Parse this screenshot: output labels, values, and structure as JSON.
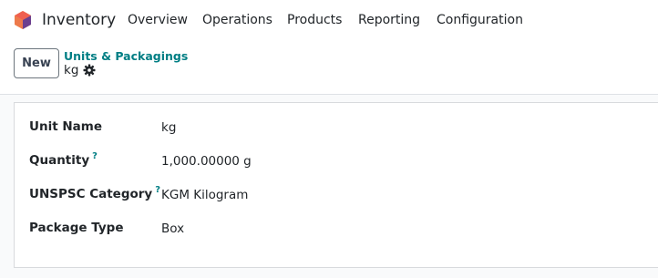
{
  "app": {
    "name": "Inventory",
    "brand_colors": [
      "#f06050",
      "#fbb130",
      "#6b3f8f"
    ]
  },
  "menu": [
    {
      "label": "Overview"
    },
    {
      "label": "Operations"
    },
    {
      "label": "Products"
    },
    {
      "label": "Reporting"
    },
    {
      "label": "Configuration"
    }
  ],
  "control_panel": {
    "new_label": "New",
    "breadcrumb": "Units & Packagings",
    "record_name": "kg",
    "actions_icon": "gear-icon"
  },
  "form": {
    "help_marker": "?",
    "fields": [
      {
        "label": "Unit Name",
        "value": "kg",
        "has_help": false
      },
      {
        "label": "Quantity",
        "value": "1,000.00000  g",
        "has_help": true
      },
      {
        "label": "UNSPSC Category",
        "value": "KGM Kilogram",
        "has_help": true
      },
      {
        "label": "Package Type",
        "value": "Box",
        "has_help": false
      }
    ]
  },
  "colors": {
    "accent": "#017e84",
    "border": "#dee2e6",
    "content_bg": "#f9fafb"
  }
}
